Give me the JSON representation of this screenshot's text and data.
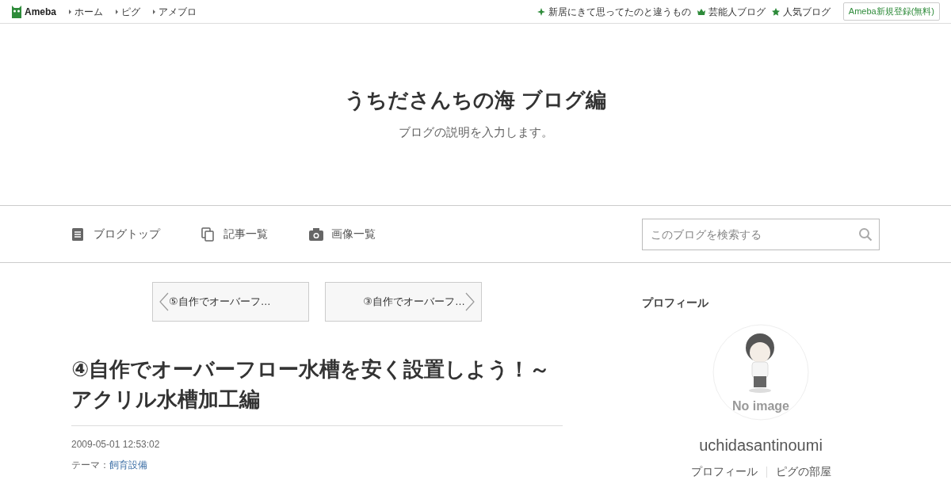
{
  "topbar": {
    "logo": "Ameba",
    "links": [
      "ホーム",
      "ピグ",
      "アメブロ"
    ],
    "right_links": [
      {
        "kind": "sparkle",
        "label": "新居にきて思ってたのと違うもの"
      },
      {
        "kind": "crown",
        "label": "芸能人ブログ"
      },
      {
        "kind": "star",
        "label": "人気ブログ"
      }
    ],
    "register_button": "Ameba新規登録(無料)"
  },
  "header": {
    "title": "うちださんちの海 ブログ編",
    "description": "ブログの説明を入力します。"
  },
  "nav": {
    "items": [
      {
        "kind": "document",
        "label": "ブログトップ"
      },
      {
        "kind": "copy",
        "label": "記事一覧"
      },
      {
        "kind": "camera",
        "label": "画像一覧"
      }
    ],
    "search": {
      "placeholder": "このブログを検索する"
    }
  },
  "article": {
    "prev": "⑤自作でオーバーフ…",
    "next": "③自作でオーバーフ…",
    "title": "④自作でオーバーフロー水槽を安く設置しよう！～アクリル水槽加工編",
    "date": "2009-05-01 12:53:02",
    "theme_label": "テーマ：",
    "theme": "飼育設備"
  },
  "sidebar": {
    "heading": "プロフィール",
    "avatar_text": "No image",
    "username": "uchidasantinoumi",
    "links": [
      "プロフィール",
      "ピグの部屋"
    ]
  }
}
